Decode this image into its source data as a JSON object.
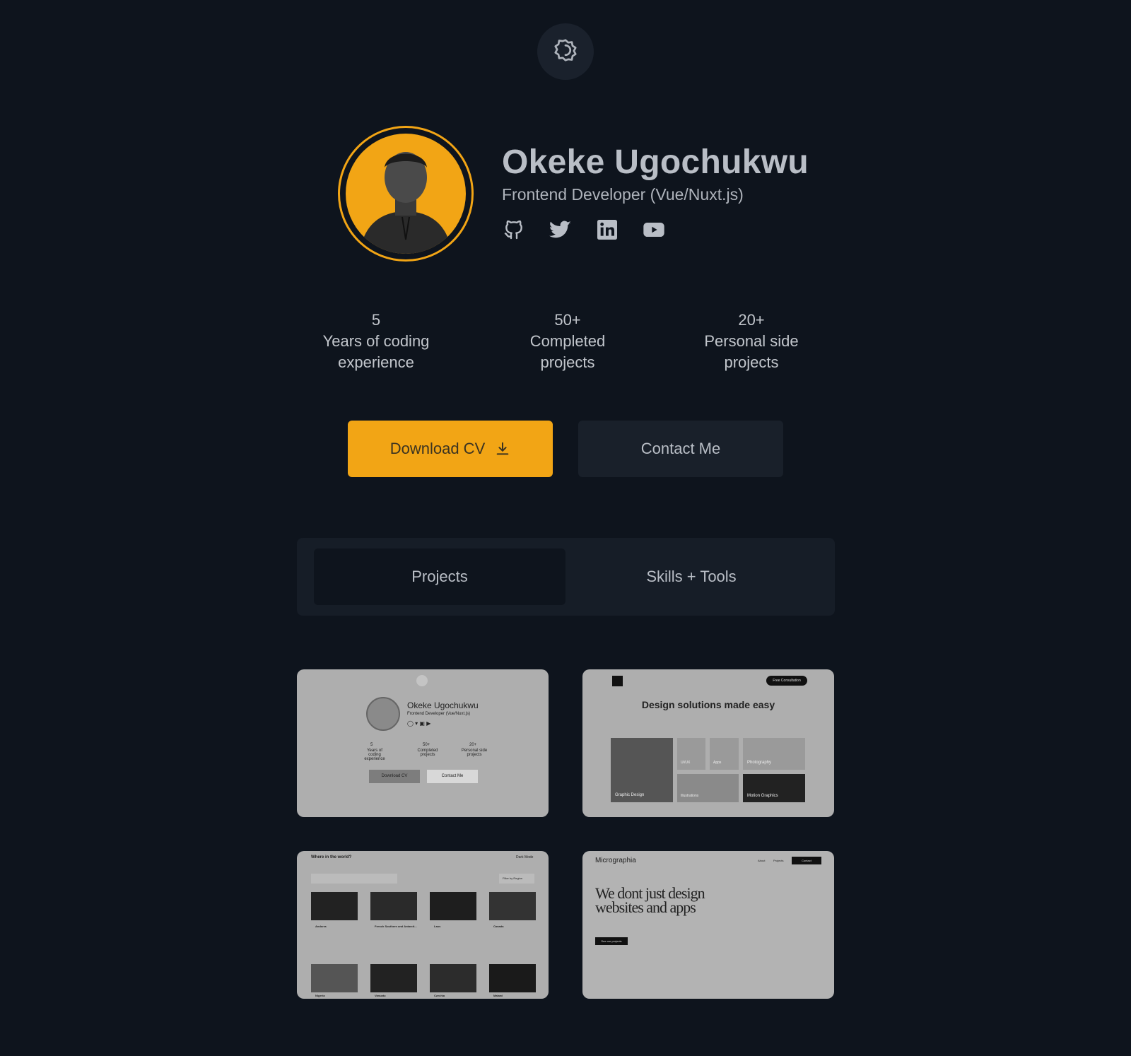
{
  "header": {
    "theme_toggle_icon": "theme-toggle-icon"
  },
  "profile": {
    "name": "Okeke Ugochukwu",
    "role": "Frontend Developer (Vue/Nuxt.js)",
    "socials": [
      {
        "icon": "github-icon"
      },
      {
        "icon": "twitter-icon"
      },
      {
        "icon": "linkedin-icon"
      },
      {
        "icon": "youtube-icon"
      }
    ],
    "accent": "#f2a515"
  },
  "stats": [
    {
      "value": "5",
      "line1": "Years of coding",
      "line2": "experience"
    },
    {
      "value": "50+",
      "line1": "Completed",
      "line2": "projects"
    },
    {
      "value": "20+",
      "line1": "Personal side",
      "line2": "projects"
    }
  ],
  "actions": {
    "download_label": "Download CV",
    "download_icon": "download-icon",
    "contact_label": "Contact Me"
  },
  "tabs": [
    {
      "label": "Projects",
      "active": true
    },
    {
      "label": "Skills + Tools",
      "active": false
    }
  ],
  "projects": [
    {
      "name": "Okeke Ugochukwu",
      "subtitle": "Frontend Developer (Vue/Nuxt.js)",
      "stats": [
        "5",
        "Years of coding experience",
        "50+",
        "Completed projects",
        "20+",
        "Personal side projects"
      ],
      "buttons": [
        "Download CV",
        "Contact Me"
      ]
    },
    {
      "badge": "Free Consultation",
      "headline": "Design solutions made easy",
      "tiles": [
        "Graphic Design",
        "UI/UX",
        "Apps",
        "Photography",
        "Illustrations",
        "Motion Graphics"
      ]
    },
    {
      "title": "Where in the world?",
      "mode": "Dark Mode",
      "filter": "Filter by Region",
      "countries": [
        "Andorra",
        "French Southern and Antarcti...",
        "Laos",
        "Canada",
        "Nigeria",
        "Vanuatu",
        "Czechia",
        "Malawi"
      ]
    },
    {
      "brand": "Micrographia",
      "nav": [
        "About",
        "Projects",
        "Contact"
      ],
      "headline1": "We dont just design",
      "headline2": "websites and apps",
      "cta": "See our projects"
    }
  ],
  "colors": {
    "background": "#0e141d",
    "surface": "#19202a",
    "accent": "#f2a515"
  }
}
